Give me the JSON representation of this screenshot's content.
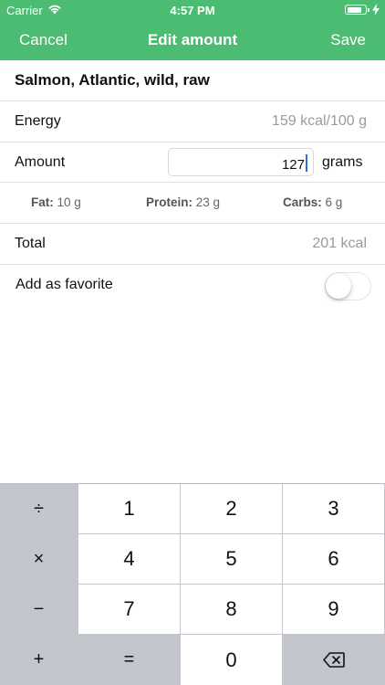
{
  "status": {
    "carrier": "Carrier",
    "time": "4:57 PM"
  },
  "nav": {
    "cancel": "Cancel",
    "title": "Edit amount",
    "save": "Save"
  },
  "food": {
    "name": "Salmon, Atlantic, wild, raw"
  },
  "energy": {
    "label": "Energy",
    "value": "159 kcal/100 g"
  },
  "amount": {
    "label": "Amount",
    "value": "127",
    "unit": "grams"
  },
  "macros": {
    "fat_label": "Fat:",
    "fat_value": "10 g",
    "protein_label": "Protein:",
    "protein_value": "23 g",
    "carbs_label": "Carbs:",
    "carbs_value": "6 g"
  },
  "total": {
    "label": "Total",
    "value": "201 kcal"
  },
  "favorite": {
    "label": "Add as favorite",
    "on": false
  },
  "keypad": {
    "divide": "÷",
    "multiply": "×",
    "minus": "−",
    "plus": "+",
    "equals": "=",
    "digits": [
      "1",
      "2",
      "3",
      "4",
      "5",
      "6",
      "7",
      "8",
      "9",
      "0"
    ],
    "backspace_icon": "delete-backward-icon"
  },
  "colors": {
    "accent": "#4cbc72"
  }
}
